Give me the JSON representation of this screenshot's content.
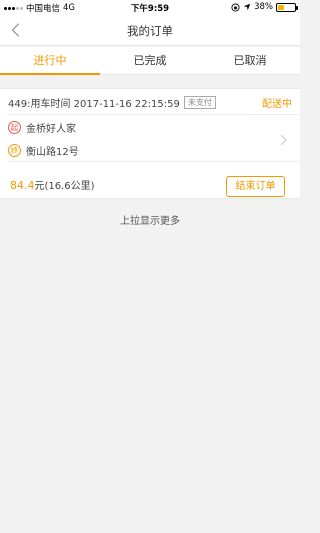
{
  "status_bar": {
    "carrier": "中国电信",
    "network": "4G",
    "time": "下午9:59",
    "battery_percent": "38%",
    "battery_level": 0.38
  },
  "nav": {
    "title": "我的订单"
  },
  "tabs": [
    {
      "label": "进行中",
      "active": true
    },
    {
      "label": "已完成",
      "active": false
    },
    {
      "label": "已取消",
      "active": false
    }
  ],
  "order": {
    "header": "449:用车时间 2017-11-16 22:15:59",
    "payment_badge": "未支付",
    "status": "配送中",
    "start_marker": "起",
    "start_address": "金桥好人家",
    "end_marker": "终",
    "end_address": "衡山路12号",
    "price_amount": "84.4",
    "price_suffix": "元(16.6公里)",
    "end_button": "结束订单"
  },
  "footer": {
    "pull_more": "上拉显示更多"
  },
  "colors": {
    "accent": "#f39800",
    "start_red": "#e9564b"
  }
}
